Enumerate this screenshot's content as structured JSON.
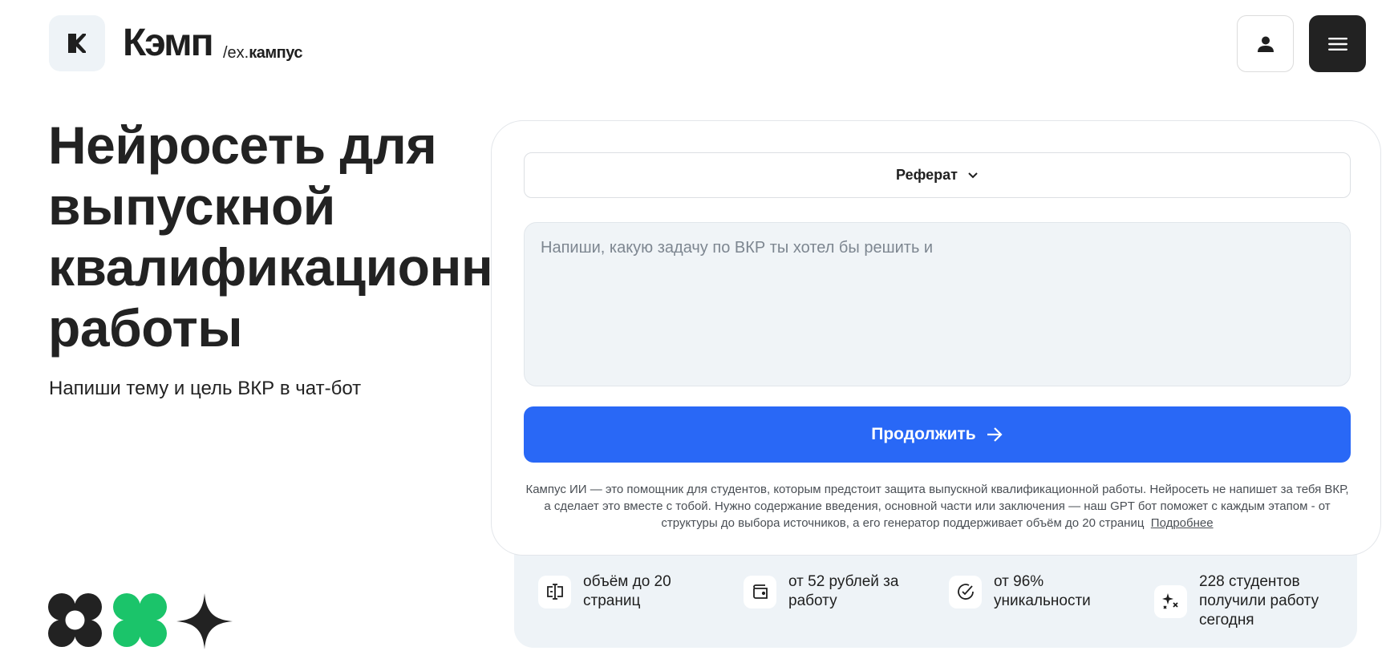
{
  "header": {
    "brand_name": "Кэмп",
    "brand_sub_prefix": "/ex.",
    "brand_sub_name": "кампус",
    "icons": {
      "logo": "k-logo-icon",
      "user": "user-icon",
      "menu": "hamburger-menu-icon"
    }
  },
  "hero": {
    "title": "Нейросеть для\nвыпускной\nквалификационной\nработы",
    "subtitle": "Напиши тему и цель ВКР в чат-бот"
  },
  "form": {
    "type_select": "Реферат",
    "task_placeholder": "Напиши, какую задачу по ВКР ты хотел бы решить и",
    "task_value": "",
    "continue_label": "Продолжить",
    "disclaimer_line1": "Кампус ИИ — это помощник для студентов, которым предстоит защита выпускной квалификационной работы. Нейросеть не напишет за тебя ВКР,",
    "disclaimer_line2": "а сделает это вместе с тобой. Нужно содержание введения, основной части или заключения — наш GPT бот поможет с каждым этапом - от",
    "disclaimer_line3": "структуры до выбора источников, а его генератор поддерживает объём до 20 страниц",
    "more_link": "Подробнее"
  },
  "stats": [
    {
      "icon": "text-cursor-icon",
      "text": "объём до 20 страниц"
    },
    {
      "icon": "wallet-icon",
      "text": "от 52 рублей за работу"
    },
    {
      "icon": "check-circle-icon",
      "text": "от 96% уникальности"
    },
    {
      "icon": "sparkles-icon",
      "text": "228 студентов получили работу сегодня"
    }
  ],
  "colors": {
    "accent": "#2968f6",
    "dark": "#222222",
    "green": "#1bc46a",
    "panel": "#eef3f7"
  }
}
